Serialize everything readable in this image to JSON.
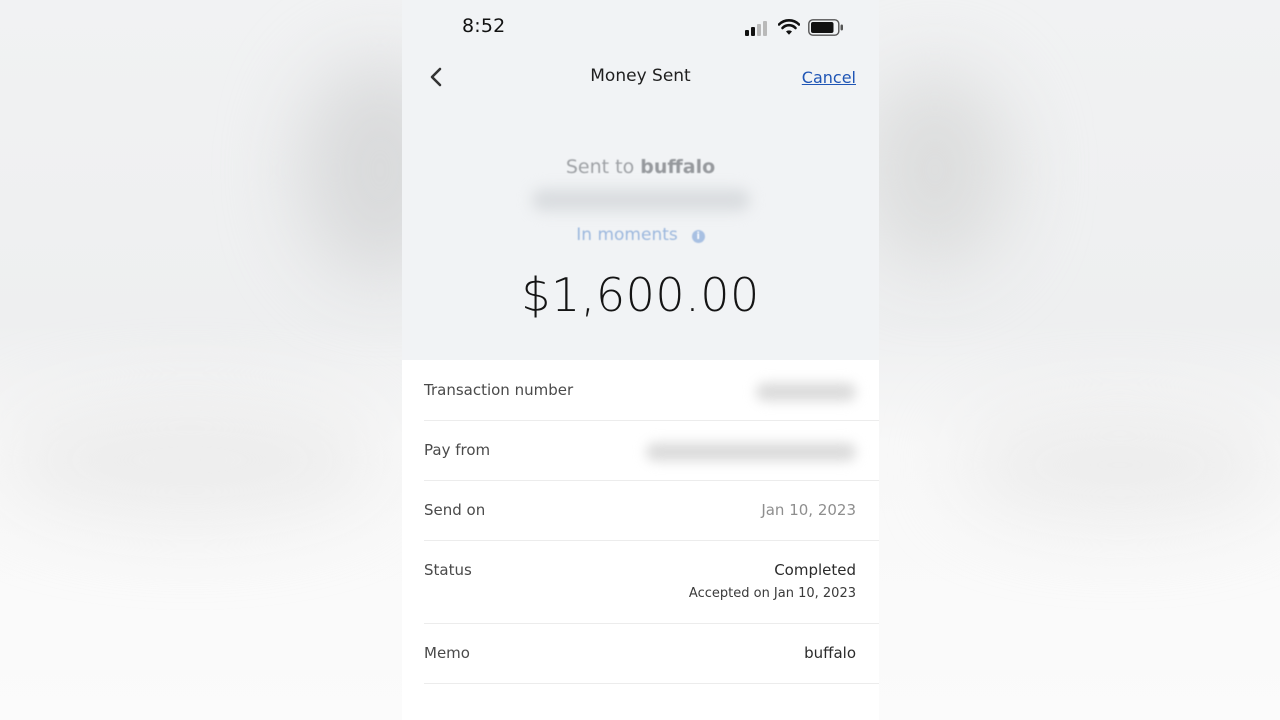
{
  "status_bar": {
    "time": "8:52"
  },
  "nav": {
    "title": "Money Sent",
    "cancel_label": "Cancel"
  },
  "summary": {
    "sent_to_prefix": "Sent to",
    "recipient_name": "buffalo",
    "timing": "In moments",
    "amount": "$1,600.00"
  },
  "details": {
    "transaction_number_label": "Transaction number",
    "pay_from_label": "Pay from",
    "send_on_label": "Send on",
    "send_on_value": "Jan 10, 2023",
    "status_label": "Status",
    "status_value": "Completed",
    "status_sub": "Accepted on Jan 10, 2023",
    "memo_label": "Memo",
    "memo_value": "buffalo"
  },
  "colors": {
    "link": "#1f55b5",
    "timing": "#9bb7dd",
    "header_bg": "#f1f3f5"
  }
}
